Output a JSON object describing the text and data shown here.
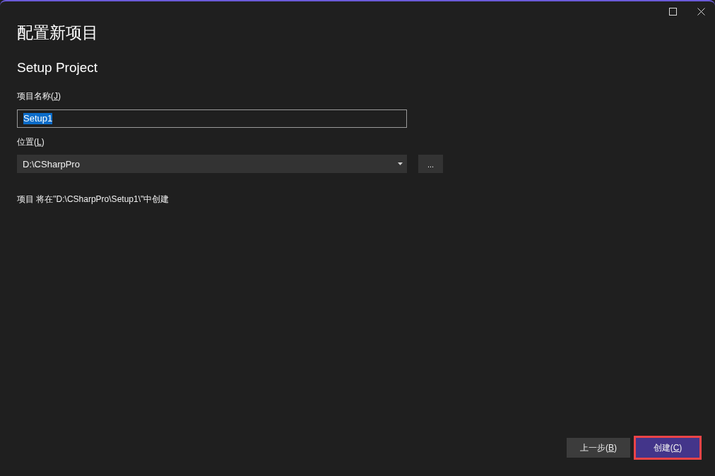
{
  "heading": "配置新项目",
  "template_name": "Setup Project",
  "fields": [
    {
      "kind": "text",
      "label": {
        "before": "项目名称(",
        "access_key": "J",
        "after": ")"
      },
      "value": "Setup1",
      "text_selected": true
    },
    {
      "kind": "dropdown",
      "label": {
        "before": "位置(",
        "access_key": "L",
        "after": ")"
      },
      "value": "D:\\CSharpPro",
      "browse_button": "..."
    }
  ],
  "location_note": "项目 将在\"D:\\CSharpPro\\Setup1\\\"中创建",
  "buttons": [
    {
      "kind": "secondary",
      "label": {
        "before": "上一步(",
        "access_key": "B",
        "after": ")"
      },
      "highlighted": false
    },
    {
      "kind": "primary",
      "label": {
        "before": "创建(",
        "access_key": "C",
        "after": ")"
      },
      "highlighted": true
    }
  ]
}
